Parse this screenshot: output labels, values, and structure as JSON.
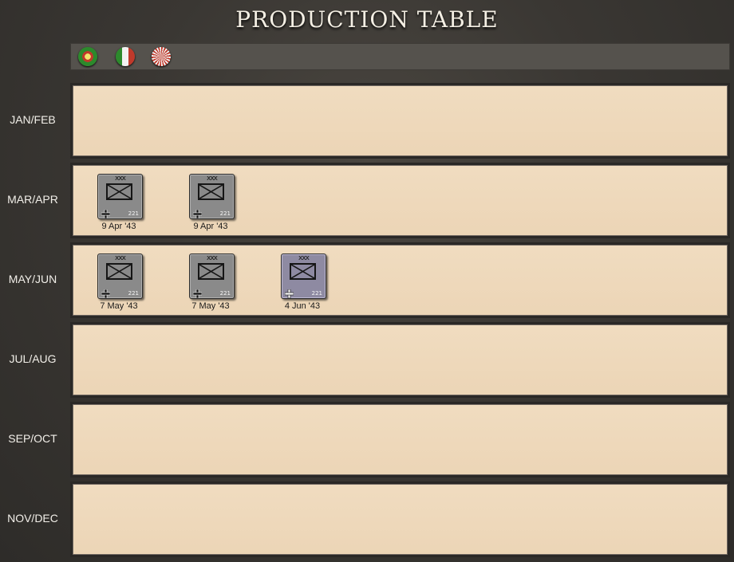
{
  "title": "PRODUCTION TABLE",
  "flags": [
    {
      "icon": "portugal-flag-icon",
      "color": "#2c8a2c"
    },
    {
      "icon": "italy-flag-icon",
      "color": "#c0392b"
    },
    {
      "icon": "japan-flag-icon",
      "color": "#c0392b"
    }
  ],
  "rows": [
    {
      "label": "JAN/FEB",
      "units": []
    },
    {
      "label": "MAR/APR",
      "units": [
        {
          "size": "xxx",
          "number": "221",
          "date": "9 Apr '43",
          "style": "gray"
        },
        {
          "size": "xxx",
          "number": "221",
          "date": "9 Apr '43",
          "style": "gray"
        }
      ]
    },
    {
      "label": "MAY/JUN",
      "units": [
        {
          "size": "xxx",
          "number": "221",
          "date": "7 May '43",
          "style": "gray"
        },
        {
          "size": "xxx",
          "number": "221",
          "date": "7 May '43",
          "style": "gray"
        },
        {
          "size": "xxx",
          "number": "221",
          "date": "4 Jun '43",
          "style": "purple"
        }
      ]
    },
    {
      "label": "JUL/AUG",
      "units": []
    },
    {
      "label": "SEP/OCT",
      "units": []
    },
    {
      "label": "NOV/DEC",
      "units": []
    }
  ],
  "colors": {
    "panel": "#ecd5b6",
    "background": "#3a3733",
    "counter_gray": "#8a8a8a",
    "counter_purple": "#8e8aa2"
  }
}
